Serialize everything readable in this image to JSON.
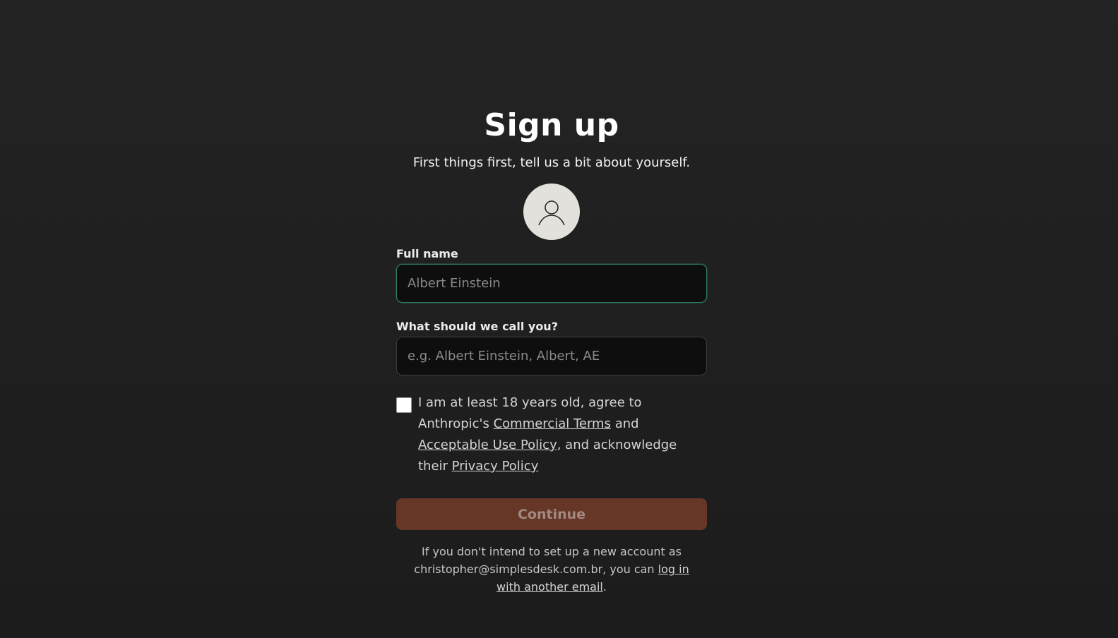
{
  "page": {
    "title": "Sign up",
    "subtitle": "First things first, tell us a bit about yourself."
  },
  "avatar": {
    "icon": "user-icon"
  },
  "form": {
    "full_name": {
      "label": "Full name",
      "placeholder": "Albert Einstein",
      "value": ""
    },
    "nickname": {
      "label": "What should we call you?",
      "placeholder": "e.g. Albert Einstein, Albert, AE",
      "value": ""
    }
  },
  "consent": {
    "checked": false,
    "text_before": "I am at least 18 years old, agree to Anthropic's ",
    "commercial_terms": "Commercial Terms",
    "text_and": " and ",
    "acceptable_use": "Acceptable Use Policy",
    "text_ack": ", and acknowledge their ",
    "privacy_policy": "Privacy Policy"
  },
  "continue_label": "Continue",
  "footnote": {
    "text": "If you don't intend to set up a new account as christopher@simplesdesk.com.br, you can ",
    "link": "log in with another email",
    "suffix": "."
  },
  "colors": {
    "background": "#1f1f1f",
    "focus_border": "#2e7d62",
    "continue_bg": "#663626",
    "continue_text": "#a28a80",
    "avatar_bg": "#e3e1dc"
  }
}
